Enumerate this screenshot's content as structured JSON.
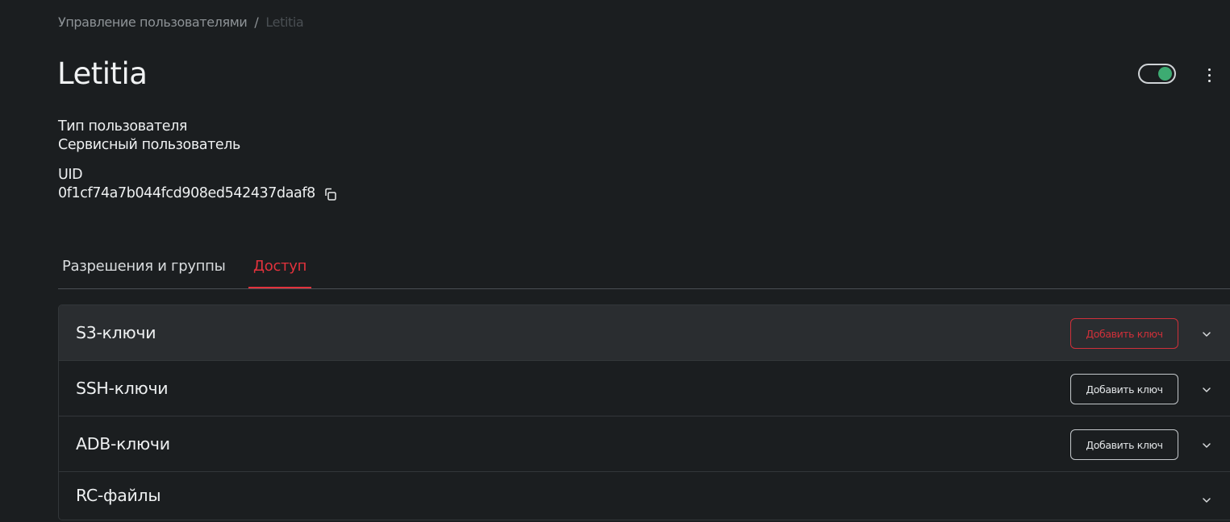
{
  "breadcrumb": {
    "parent": "Управление пользователями",
    "separator": "/",
    "current": "Letitia"
  },
  "user": {
    "name": "Letitia",
    "enabled": true,
    "type_label": "Тип пользователя",
    "type_value": "Сервисный пользователь",
    "uid_label": "UID",
    "uid_value": "0f1cf74a7b044fcd908ed542437daaf8"
  },
  "tabs": [
    {
      "label": "Разрешения и группы",
      "active": false
    },
    {
      "label": "Доступ",
      "active": true
    }
  ],
  "sections": [
    {
      "title": "S3-ключи",
      "button": "Добавить ключ",
      "expanded": true
    },
    {
      "title": "SSH-ключи",
      "button": "Добавить ключ",
      "expanded": false
    },
    {
      "title": "ADB-ключи",
      "button": "Добавить ключ",
      "expanded": false
    },
    {
      "title": "RC-файлы",
      "expanded": false
    }
  ],
  "icons": {
    "copy": "copy-icon",
    "more": "more-vertical-icon",
    "chevron": "chevron-down-icon"
  },
  "colors": {
    "background": "#1b1e20",
    "accent": "#e2323c",
    "toggle_on": "#3dab72",
    "text": "#e9ebec",
    "muted": "#8e9397"
  }
}
